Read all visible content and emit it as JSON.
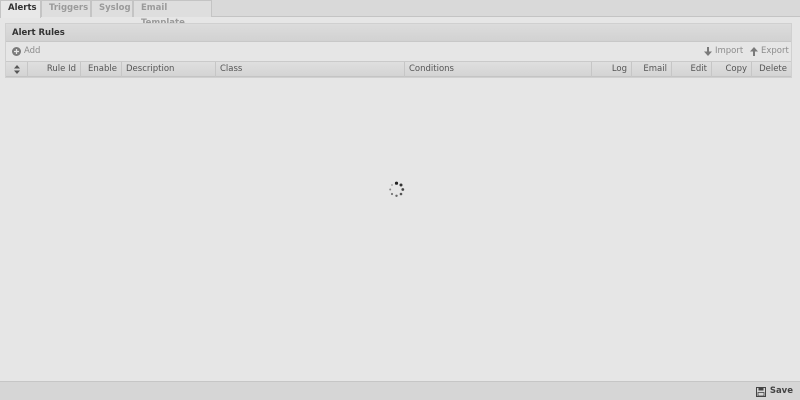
{
  "tabs": [
    {
      "label": "Alerts",
      "active": true
    },
    {
      "label": "Triggers",
      "active": false
    },
    {
      "label": "Syslog",
      "active": false
    },
    {
      "label": "Email Template",
      "active": false
    }
  ],
  "panel": {
    "title": "Alert Rules",
    "toolbar": {
      "add_label": "Add",
      "import_label": "Import",
      "export_label": "Export"
    },
    "columns": [
      "Rule Id",
      "Enable",
      "Description",
      "Class",
      "Conditions",
      "Log",
      "Email",
      "Edit",
      "Copy",
      "Delete"
    ]
  },
  "icons": {
    "add": "plus-circle-icon",
    "import": "arrow-down-icon",
    "export": "arrow-up-icon",
    "sort": "sort-icon",
    "loading": "spinner-icon",
    "save": "floppy-disk-icon"
  },
  "footer": {
    "save_label": "Save"
  },
  "colors": {
    "background": "#e6e6e6",
    "tab_inactive_text": "#9a9a9a",
    "header_text": "#333333"
  }
}
